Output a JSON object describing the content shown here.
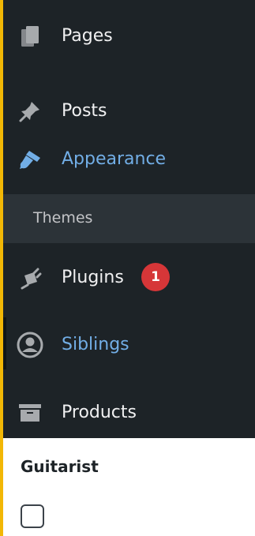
{
  "sidebar": {
    "items": [
      {
        "name": "pages",
        "label": "Pages",
        "icon": "pages-icon"
      },
      {
        "name": "posts",
        "label": "Posts",
        "icon": "pushpin-icon"
      },
      {
        "name": "appearance",
        "label": "Appearance",
        "icon": "paintbrush-icon"
      },
      {
        "name": "plugins",
        "label": "Plugins",
        "icon": "plugin-icon",
        "badge": "1"
      },
      {
        "name": "siblings",
        "label": "Siblings",
        "icon": "user-circle-icon"
      },
      {
        "name": "products",
        "label": "Products",
        "icon": "archive-icon"
      }
    ],
    "submenu": {
      "label": "Themes"
    }
  },
  "content": {
    "field_label": "Guitarist",
    "checkbox_checked": false
  },
  "colors": {
    "sidebar_bg": "#1d2327",
    "submenu_bg": "#2c3338",
    "text": "#f0f0f1",
    "active_text": "#72aee6",
    "badge_bg": "#d63638",
    "frame_border": "#f2b705"
  }
}
